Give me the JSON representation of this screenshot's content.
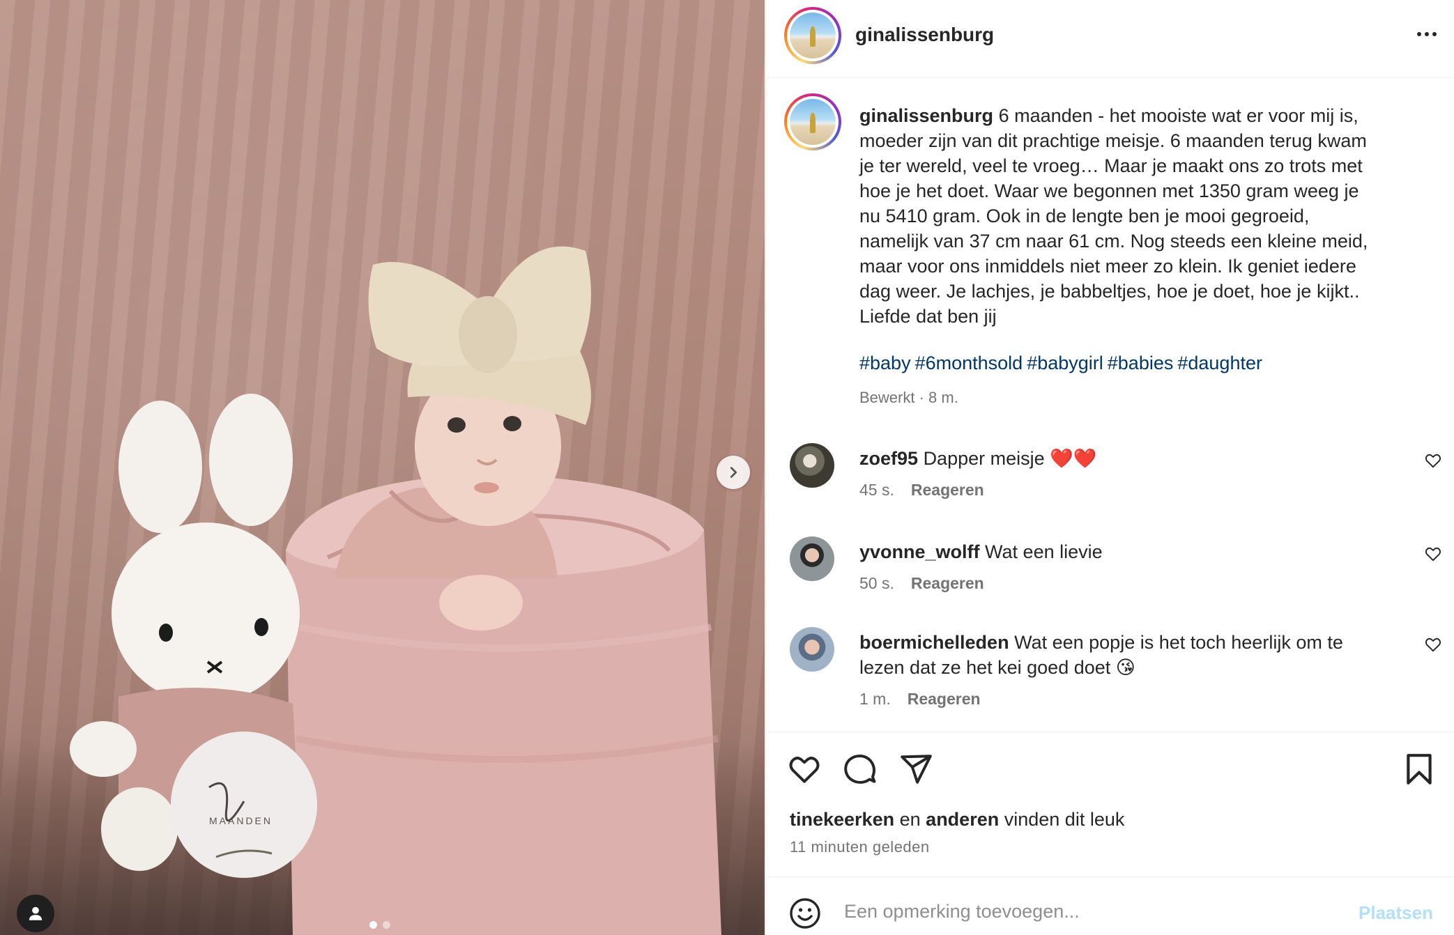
{
  "post": {
    "username": "ginalissenburg",
    "caption": "6 maanden - het mooiste wat er voor mij is,\nmoeder zijn van dit prachtige meisje. 6 maanden terug kwam\nje ter wereld, veel te vroeg… Maar je maakt ons zo trots met\nhoe je het doet. Waar we begonnen met 1350 gram weeg je\nnu 5410 gram. Ook in de lengte ben je mooi gegroeid,\nnamelijk van 37 cm naar 61 cm. Nog steeds een kleine meid,\nmaar voor ons inmiddels niet meer zo klein. Ik geniet iedere\ndag weer. Je lachjes, je babbeltjes, hoe je doet, hoe je kijkt..\nLiefde dat ben jij",
    "hashtags": [
      "#baby",
      "#6monthsold",
      "#babygirl",
      "#babies",
      "#daughter"
    ],
    "caption_meta": "Bewerkt · 8 m.",
    "carousel_pages": 2,
    "carousel_current": 1
  },
  "photo": {
    "card_text": "MAANDEN",
    "card_script": "Zes"
  },
  "comments": [
    {
      "username": "zoef95",
      "text": "Dapper meisje ❤️❤️",
      "time": "45 s.",
      "reply": "Reageren"
    },
    {
      "username": "yvonne_wolff",
      "text": "Wat een lievie",
      "time": "50 s.",
      "reply": "Reageren"
    },
    {
      "username": "boermichelleden",
      "text": "Wat een popje is het toch heerlijk om te\nlezen dat ze het kei goed doet 😘",
      "time": "1 m.",
      "reply": "Reageren"
    }
  ],
  "likes": {
    "user": "tinekeerken",
    "connector": "en",
    "others": "anderen",
    "suffix": "vinden dit leuk",
    "time": "11 minuten geleden"
  },
  "add_comment": {
    "placeholder": "Een opmerking toevoegen...",
    "post_label": "Plaatsen"
  },
  "icons": {
    "more": "more-horizontal-icon",
    "next": "chevron-right-icon",
    "tag_user": "user-tag-icon",
    "like": "heart-icon",
    "comment": "comment-bubble-icon",
    "share": "paper-plane-icon",
    "save": "bookmark-icon",
    "emoji": "emoji-smile-icon"
  },
  "colors": {
    "link": "#00376b",
    "muted": "#737373",
    "post_button_disabled": "#b2dffc"
  }
}
